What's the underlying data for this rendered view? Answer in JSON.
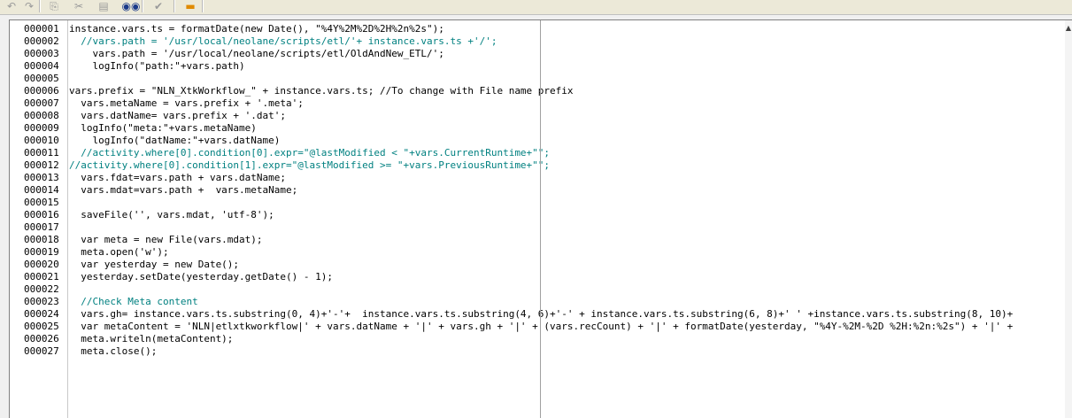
{
  "toolbar": {
    "buttons": [
      {
        "name": "undo-button",
        "icon": "undo-icon",
        "glyph": "↶"
      },
      {
        "name": "redo-button",
        "icon": "redo-icon",
        "glyph": "↷"
      },
      {
        "name": "copy-button",
        "icon": "copy-icon",
        "glyph": "⎘"
      },
      {
        "name": "cut-button",
        "icon": "cut-icon",
        "glyph": "✂"
      },
      {
        "name": "paste-button",
        "icon": "paste-icon",
        "glyph": "▤"
      },
      {
        "name": "find-button",
        "icon": "binoculars-icon",
        "glyph": "◉◉"
      },
      {
        "name": "validate-button",
        "icon": "check-icon",
        "glyph": "✔"
      },
      {
        "name": "insert-button",
        "icon": "insert-icon",
        "glyph": "▬"
      }
    ]
  },
  "editor": {
    "line_numbers": [
      "000001",
      "000002",
      "000003",
      "000004",
      "000005",
      "000006",
      "000007",
      "000008",
      "000009",
      "000010",
      "000011",
      "000012",
      "000013",
      "000014",
      "000015",
      "000016",
      "000017",
      "000018",
      "000019",
      "000020",
      "000021",
      "000022",
      "000023",
      "000024",
      "000025",
      "000026",
      "000027"
    ],
    "lines": [
      "instance.vars.ts = formatDate(new Date(), \"%4Y%2M%2D%2H%2n%2s\");",
      "  //vars.path = '/usr/local/neolane/scripts/etl/'+ instance.vars.ts +'/';",
      "    vars.path = '/usr/local/neolane/scripts/etl/OldAndNew_ETL/';",
      "    logInfo(\"path:\"+vars.path)",
      "",
      "vars.prefix = \"NLN_XtkWorkflow_\" + instance.vars.ts; //To change with File name prefix",
      "  vars.metaName = vars.prefix + '.meta';",
      "  vars.datName= vars.prefix + '.dat';",
      "  logInfo(\"meta:\"+vars.metaName)",
      "    logInfo(\"datName:\"+vars.datName)",
      "  //activity.where[0].condition[0].expr=\"@lastModified < \"+vars.CurrentRuntime+\"\";",
      "//activity.where[0].condition[1].expr=\"@lastModified >= \"+vars.PreviousRuntime+\"\";",
      "  vars.fdat=vars.path + vars.datName;",
      "  vars.mdat=vars.path +  vars.metaName;",
      "",
      "  saveFile('', vars.mdat, 'utf-8');",
      "",
      "  var meta = new File(vars.mdat);",
      "  meta.open('w');",
      "  var yesterday = new Date();",
      "  yesterday.setDate(yesterday.getDate() - 1);",
      "",
      "  //Check Meta content",
      "  vars.gh= instance.vars.ts.substring(0, 4)+'-'+  instance.vars.ts.substring(4, 6)+'-' + instance.vars.ts.substring(6, 8)+' ' +instance.vars.ts.substring(8, 10)+",
      "  var metaContent = 'NLN|etlxtkworkflow|' + vars.datName + '|' + vars.gh + '|' + (vars.recCount) + '|' + formatDate(yesterday, \"%4Y-%2M-%2D %2H:%2n:%2s\") + '|' +",
      "  meta.writeln(metaContent);",
      "  meta.close();"
    ]
  },
  "scrollbar": {
    "up_glyph": "▲",
    "down_glyph": "▼"
  },
  "colors": {
    "keyword": "#0000cc",
    "string": "#008080",
    "comment": "#008080",
    "text": "#000000"
  }
}
